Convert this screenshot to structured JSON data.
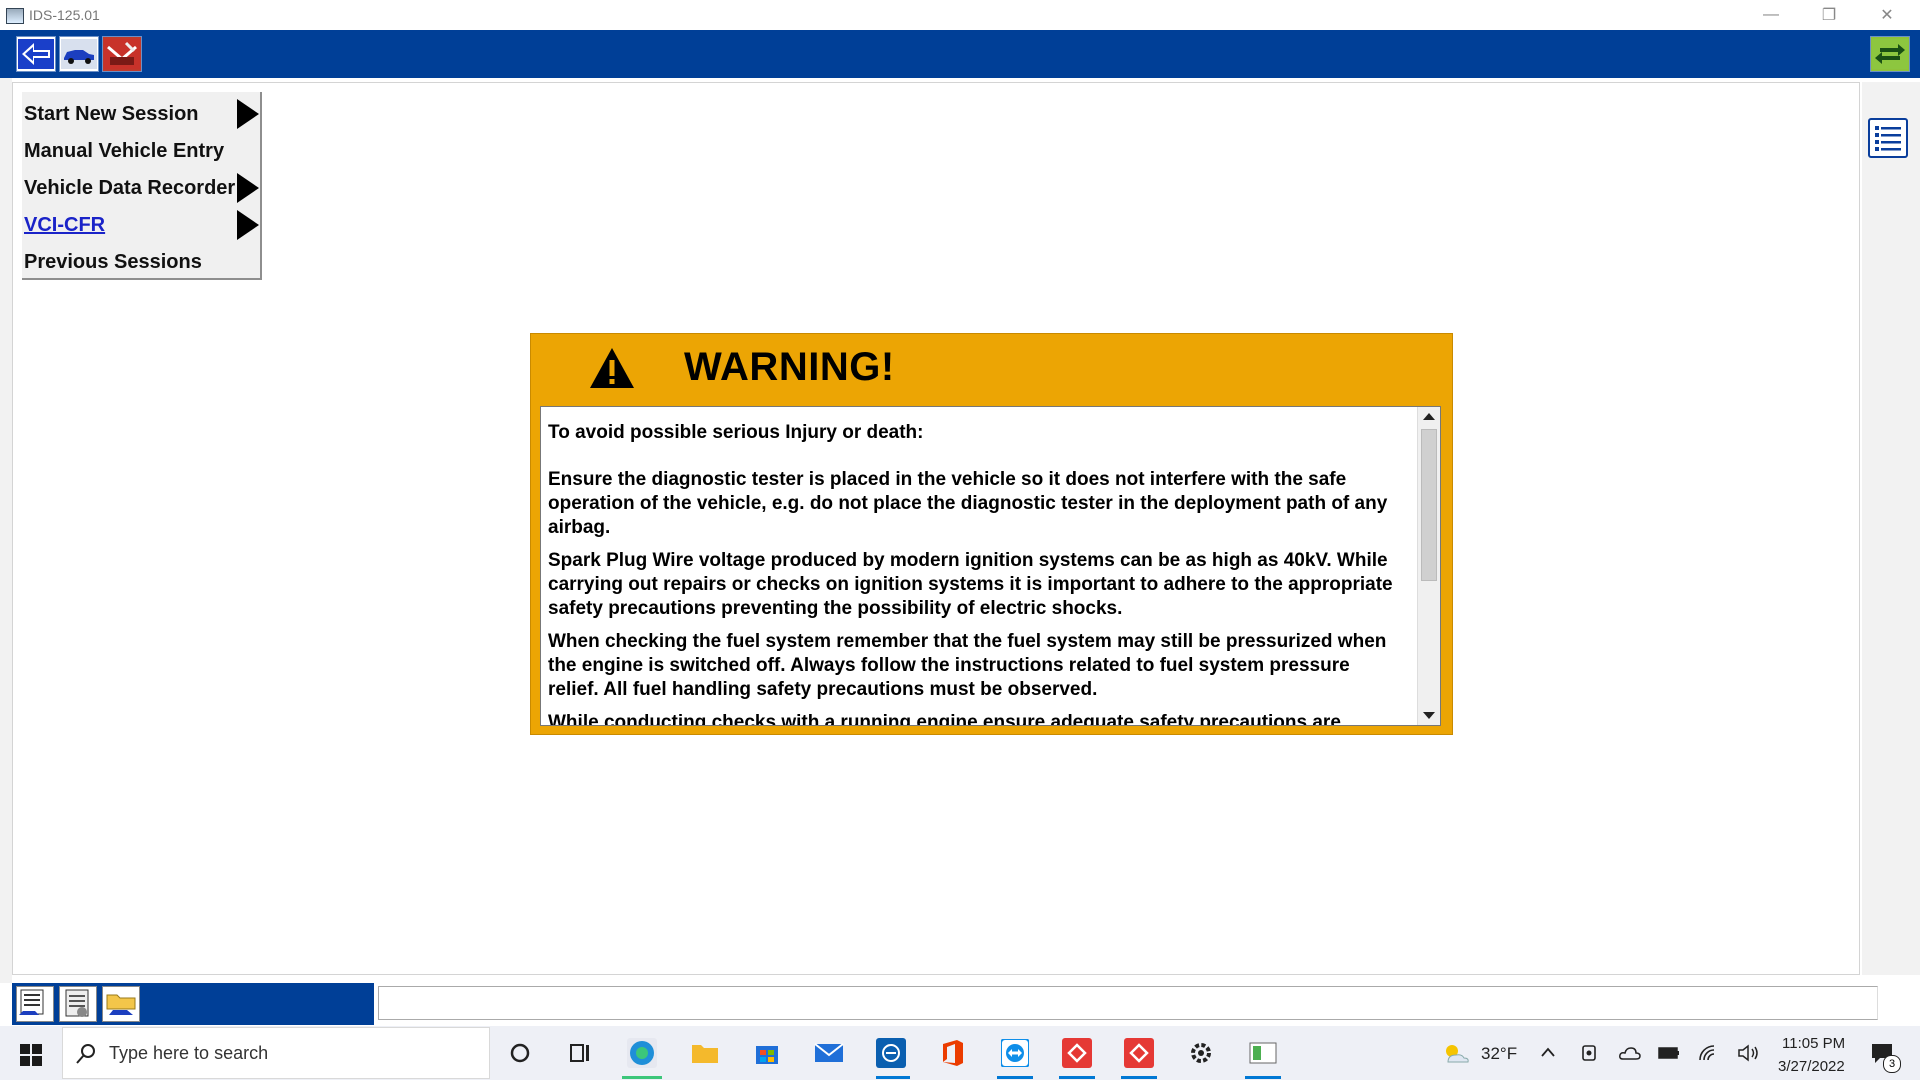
{
  "window": {
    "title": "IDS-125.01",
    "minimize_glyph": "—",
    "restore_glyph": "❐",
    "close_glyph": "✕"
  },
  "menu": {
    "items": [
      {
        "label": "Start New Session",
        "has_arrow": true,
        "link": false
      },
      {
        "label": "Manual Vehicle Entry",
        "has_arrow": false,
        "link": false
      },
      {
        "label": "Vehicle Data Recorder",
        "has_arrow": true,
        "link": false
      },
      {
        "label": "VCI-CFR",
        "has_arrow": true,
        "link": true
      },
      {
        "label": "Previous Sessions",
        "has_arrow": false,
        "link": false
      }
    ]
  },
  "warning": {
    "title": "WARNING!",
    "paragraphs": [
      "To avoid possible serious Injury or death:",
      "Ensure the diagnostic tester is placed in the vehicle so it does not interfere with the safe operation of the vehicle, e.g. do not place the diagnostic tester in the deployment path of any airbag.",
      "Spark Plug Wire voltage produced by modern ignition systems can be as high as 40kV. While carrying out repairs or checks on ignition systems it is important to adhere to the appropriate safety precautions preventing the possibility of electric shocks.",
      "When checking the fuel system remember that the fuel system may still be pressurized when the engine is switched off. Always follow the instructions related to fuel system pressure relief. All fuel handling safety precautions must be observed.",
      "While conducting checks with a running engine ensure adequate safety precautions are"
    ],
    "colors": {
      "banner": "#eca504"
    }
  },
  "taskbar": {
    "search_placeholder": "Type here to search",
    "weather": "32°F",
    "time": "11:05 PM",
    "date": "3/27/2022",
    "notification_count": "3"
  },
  "colors": {
    "toolbar_blue": "#003f97",
    "link_blue": "#1a23c8"
  }
}
